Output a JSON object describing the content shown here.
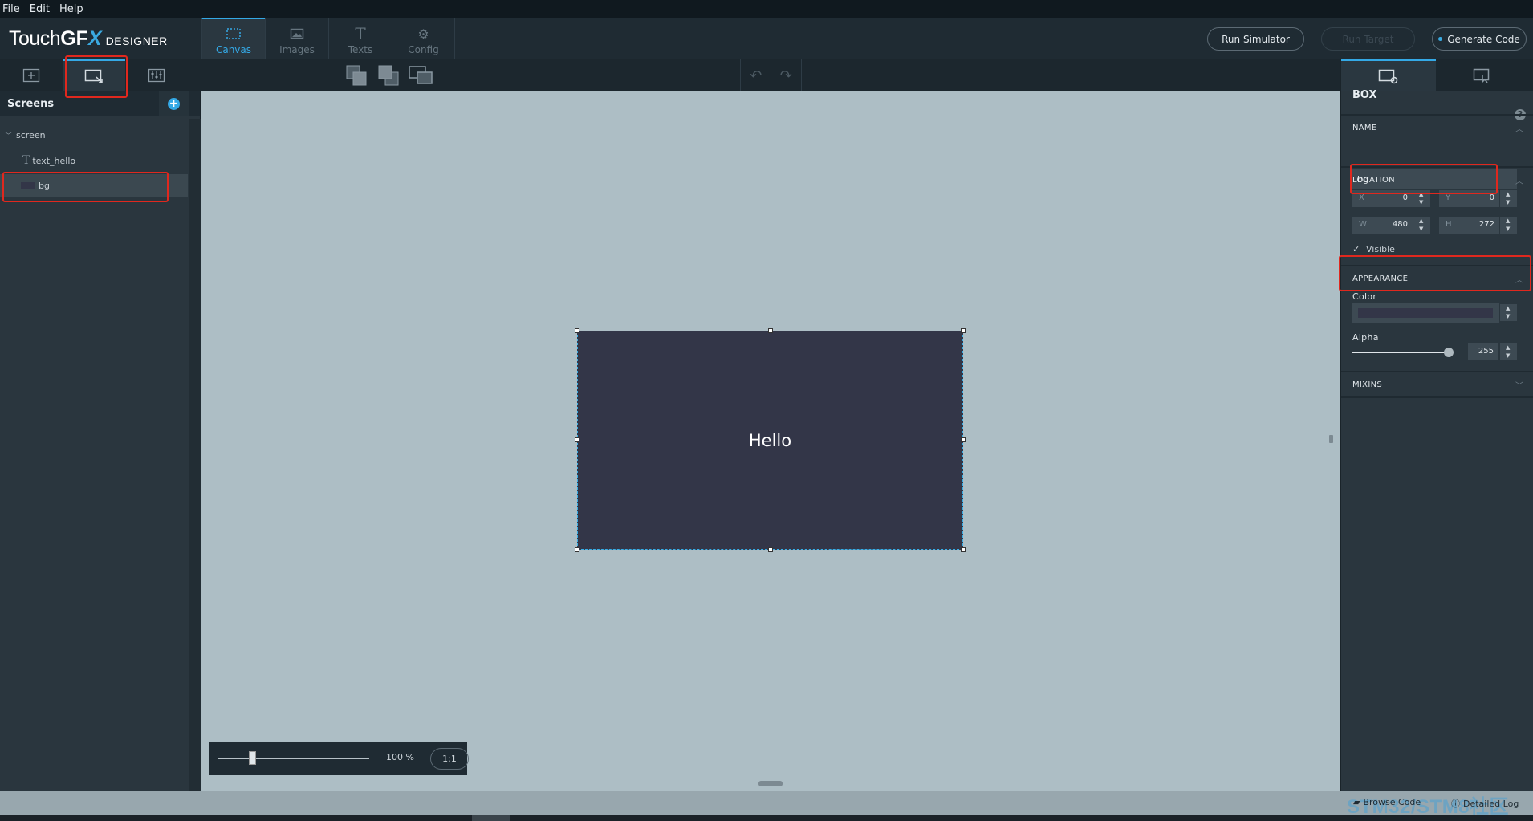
{
  "menu": {
    "items": [
      "File",
      "Edit",
      "Help"
    ]
  },
  "header": {
    "logo": {
      "part1": "Touch",
      "part2": "GF",
      "part3": "X",
      "part4": "DESIGNER"
    },
    "tabs": [
      {
        "label": "Canvas",
        "icon": "canvas-icon",
        "active": true
      },
      {
        "label": "Images",
        "icon": "images-icon",
        "active": false
      },
      {
        "label": "Texts",
        "icon": "texts-icon",
        "active": false
      },
      {
        "label": "Config",
        "icon": "config-icon",
        "active": false
      }
    ],
    "run_simulator": "Run Simulator",
    "run_target": "Run Target",
    "generate_code": "Generate Code"
  },
  "left_toolbar": {
    "items": [
      "add-widget-icon",
      "widget-tree-icon",
      "interactions-icon"
    ],
    "active_index": 1
  },
  "screens_panel": {
    "title": "Screens",
    "add_button": "+",
    "tree": {
      "screen": "screen",
      "children": [
        {
          "label": "text_hello",
          "icon": "text-icon"
        },
        {
          "label": "bg",
          "icon": "box-color-icon",
          "selected": true
        }
      ]
    }
  },
  "canvas": {
    "hello_text": "Hello",
    "box_color": "#333648",
    "background_color": "#adbec5",
    "zoom": {
      "percent": "100 %",
      "ratio": "1:1",
      "level": 0.25
    }
  },
  "properties": {
    "widget_type": "BOX",
    "help": "?",
    "name": {
      "label": "NAME",
      "value": "bg"
    },
    "location": {
      "label": "LOCATION",
      "x_label": "X",
      "x": "0",
      "y_label": "Y",
      "y": "0",
      "w_label": "W",
      "w": "480",
      "h_label": "H",
      "h": "272",
      "visible_label": "Visible",
      "visible": true
    },
    "appearance": {
      "label": "APPEARANCE",
      "color_label": "Color",
      "color_value": "#333648",
      "alpha_label": "Alpha",
      "alpha": "255"
    },
    "mixins": {
      "label": "MIXINS"
    }
  },
  "bottom": {
    "browse_code": "Browse Code",
    "detailed_log": "Detailed Log",
    "watermark": "STM32/STM8社区"
  },
  "colors": {
    "accent": "#34a9e6",
    "highlight": "#e0281e"
  }
}
